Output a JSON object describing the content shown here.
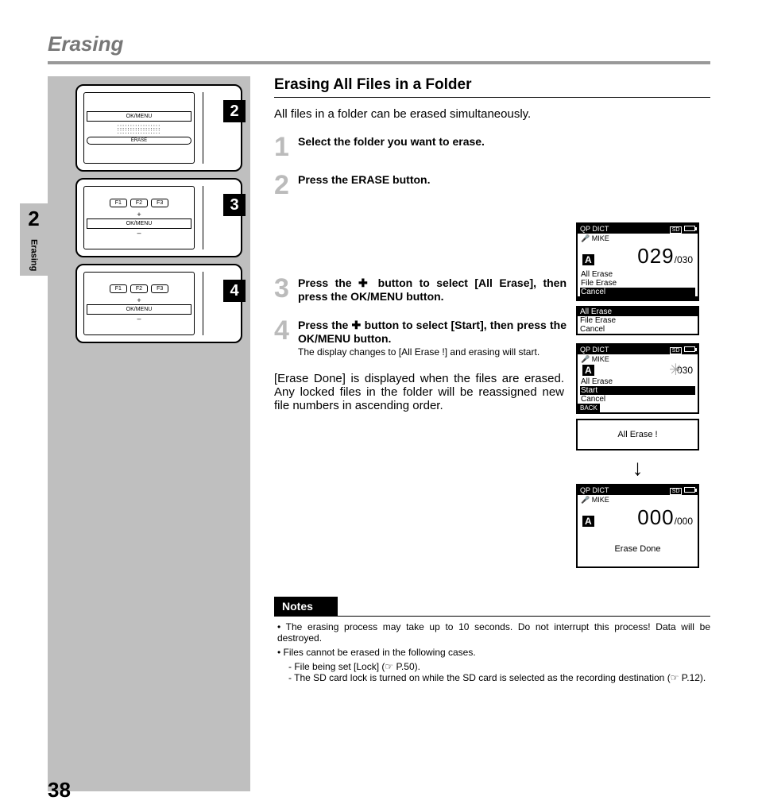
{
  "header": {
    "title": "Erasing"
  },
  "side": {
    "chapter": "2",
    "label": "Erasing"
  },
  "device_labels": {
    "ok": "OK/MENU",
    "erase": "ERASE",
    "f1": "F1",
    "f2": "F2",
    "f3": "F3"
  },
  "badges": [
    "2",
    "3",
    "4"
  ],
  "section": {
    "title": "Erasing All Files in a Folder"
  },
  "intro": "All files in a folder can be erased simultaneously.",
  "steps": [
    {
      "num": "1",
      "head": "Select the folder you want to erase."
    },
    {
      "num": "2",
      "head": "Press the ERASE button."
    },
    {
      "num": "3",
      "head": "Press the ✚ button to select [All Erase], then press the OK/MENU button."
    },
    {
      "num": "4",
      "head": "Press the ✚ button to select [Start], then press the OK/MENU button.",
      "sub": "The display changes to [All Erase !] and erasing will start."
    }
  ],
  "result": "[Erase Done] is displayed when the files are erased. Any locked files in the folder will be reassigned new file numbers in ascending order.",
  "lcd": {
    "mode": "QP DICT",
    "sd": "SD",
    "mike": "MIKE",
    "folder": "A",
    "screen1": {
      "cur": "029",
      "tot": "/030",
      "menu": [
        "All Erase",
        "File Erase",
        "Cancel"
      ],
      "hl": 2
    },
    "menu2": {
      "items": [
        "All Erase",
        "File Erase",
        "Cancel"
      ],
      "hl": 0
    },
    "screen3": {
      "tot": "030",
      "menu": [
        "All Erase",
        "Start",
        "Cancel"
      ],
      "hl": 1,
      "back": "BACK"
    },
    "erasing": "All Erase !",
    "screen5": {
      "cur": "000",
      "tot": "/000",
      "msg": "Erase Done"
    }
  },
  "notes": {
    "title": "Notes",
    "items": [
      "The erasing process may take up to 10 seconds. Do not interrupt this process! Data will be destroyed.",
      "Files cannot be erased in the following cases."
    ],
    "subs": [
      "- File being set [Lock] (☞ P.50).",
      "- The SD card lock is turned on while the SD card is selected as the recording destination (☞ P.12)."
    ]
  },
  "pagenum": "38"
}
